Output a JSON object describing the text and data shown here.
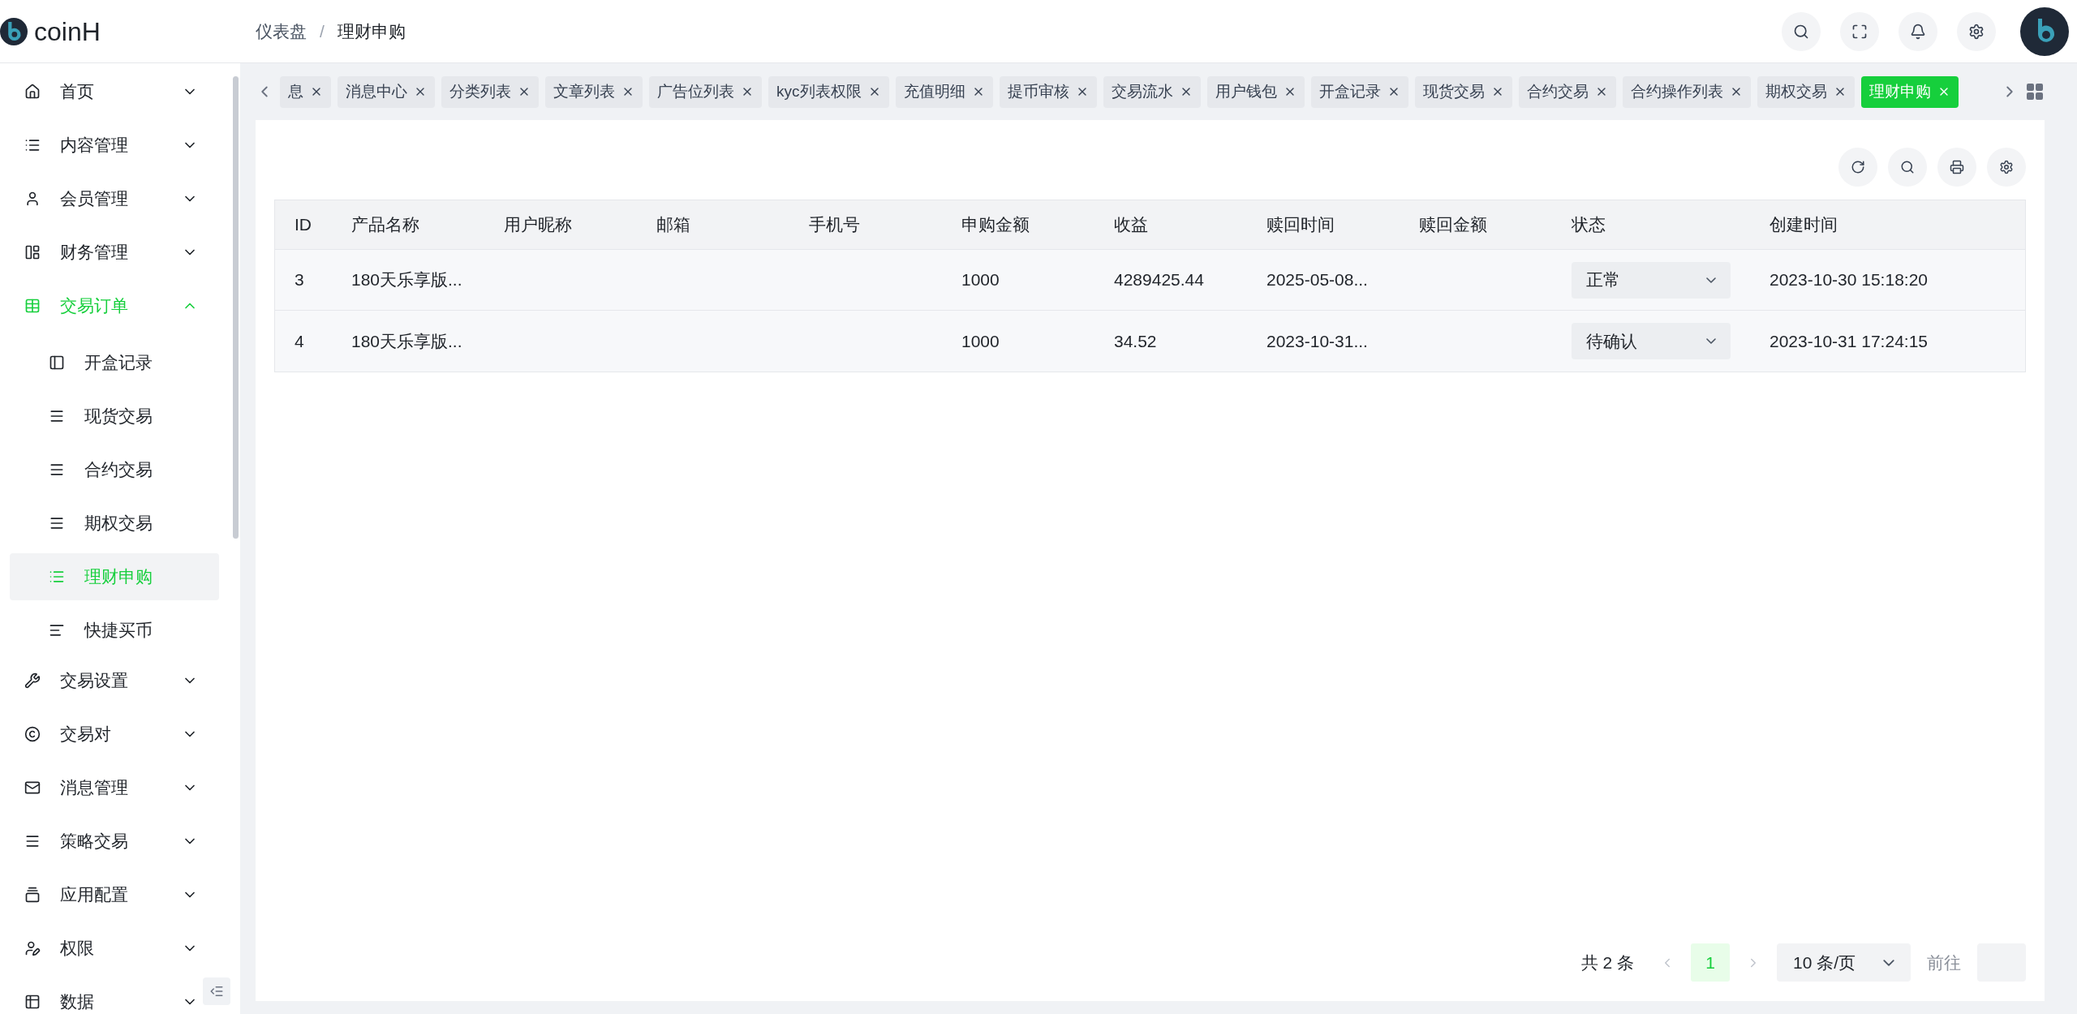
{
  "logo": {
    "name": "coinH"
  },
  "breadcrumb": [
    {
      "label": "仪表盘"
    },
    {
      "label": "/"
    },
    {
      "label": "理财申购"
    }
  ],
  "sidebar": {
    "items": [
      {
        "label": "首页",
        "selected": false,
        "expanded": false
      },
      {
        "label": "内容管理",
        "selected": false,
        "expanded": false
      },
      {
        "label": "会员管理",
        "selected": false,
        "expanded": false
      },
      {
        "label": "财务管理",
        "selected": false,
        "expanded": false
      },
      {
        "label": "交易订单",
        "selected": true,
        "expanded": true,
        "children": [
          {
            "label": "开盒记录",
            "selected": false
          },
          {
            "label": "现货交易",
            "selected": false
          },
          {
            "label": "合约交易",
            "selected": false
          },
          {
            "label": "期权交易",
            "selected": false
          },
          {
            "label": "理财申购",
            "selected": true
          },
          {
            "label": "快捷买币",
            "selected": false
          }
        ]
      },
      {
        "label": "交易设置",
        "selected": false,
        "expanded": false
      },
      {
        "label": "交易对",
        "selected": false,
        "expanded": false
      },
      {
        "label": "消息管理",
        "selected": false,
        "expanded": false
      },
      {
        "label": "策略交易",
        "selected": false,
        "expanded": false
      },
      {
        "label": "应用配置",
        "selected": false,
        "expanded": false
      },
      {
        "label": "权限",
        "selected": false,
        "expanded": false
      },
      {
        "label": "数据",
        "selected": false,
        "expanded": false
      }
    ]
  },
  "tabs": [
    {
      "label": "息",
      "selected": false
    },
    {
      "label": "消息中心",
      "selected": false
    },
    {
      "label": "分类列表",
      "selected": false
    },
    {
      "label": "文章列表",
      "selected": false
    },
    {
      "label": "广告位列表",
      "selected": false
    },
    {
      "label": "kyc列表权限",
      "selected": false
    },
    {
      "label": "充值明细",
      "selected": false
    },
    {
      "label": "提币审核",
      "selected": false
    },
    {
      "label": "交易流水",
      "selected": false
    },
    {
      "label": "用户钱包",
      "selected": false
    },
    {
      "label": "开盒记录",
      "selected": false
    },
    {
      "label": "现货交易",
      "selected": false
    },
    {
      "label": "合约交易",
      "selected": false
    },
    {
      "label": "合约操作列表",
      "selected": false
    },
    {
      "label": "期权交易",
      "selected": false
    },
    {
      "label": "理财申购",
      "selected": true
    }
  ],
  "table": {
    "columns": [
      "ID",
      "产品名称",
      "用户昵称",
      "邮箱",
      "手机号",
      "申购金额",
      "收益",
      "赎回时间",
      "赎回金额",
      "状态",
      "创建时间"
    ],
    "rows": [
      {
        "cells": [
          "3",
          "180天乐享版...",
          "",
          "",
          "",
          "1000",
          "4289425.44",
          "2025-05-08...",
          ""
        ],
        "status": "正常",
        "created": "2023-10-30 15:18:20"
      },
      {
        "cells": [
          "4",
          "180天乐享版...",
          "",
          "",
          "",
          "1000",
          "34.52",
          "2023-10-31...",
          ""
        ],
        "status": "待确认",
        "created": "2023-10-31 17:24:15"
      }
    ]
  },
  "pagination": {
    "total": "共 2 条",
    "pages": [
      {
        "label": "1",
        "selected": true
      }
    ],
    "page_size": "10 条/页",
    "goto": "前往"
  }
}
